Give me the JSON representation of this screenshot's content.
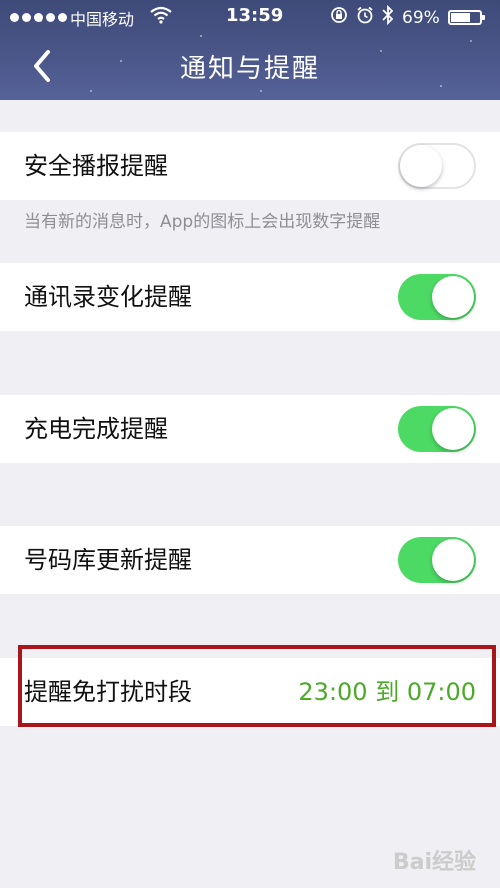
{
  "status_bar": {
    "carrier": "中国移动",
    "time": "13:59",
    "battery_pct": "69%",
    "battery_level": 0.69
  },
  "nav": {
    "title": "通知与提醒",
    "back_icon": "chevron-left-icon"
  },
  "settings": [
    {
      "label": "安全播报提醒",
      "on": false
    },
    {
      "label": "通讯录变化提醒",
      "on": true
    },
    {
      "label": "充电完成提醒",
      "on": true
    },
    {
      "label": "号码库更新提醒",
      "on": true
    }
  ],
  "hint": "当有新的消息时，App的图标上会出现数字提醒",
  "dnd": {
    "label": "提醒免打扰时段",
    "range": "23:00 到 07:00"
  },
  "colors": {
    "toggle_on": "#4cd964",
    "accent_green": "#4caa28",
    "highlight_red": "#a8151a",
    "header_blue": "#4a5688"
  },
  "watermark": "Bai经验"
}
